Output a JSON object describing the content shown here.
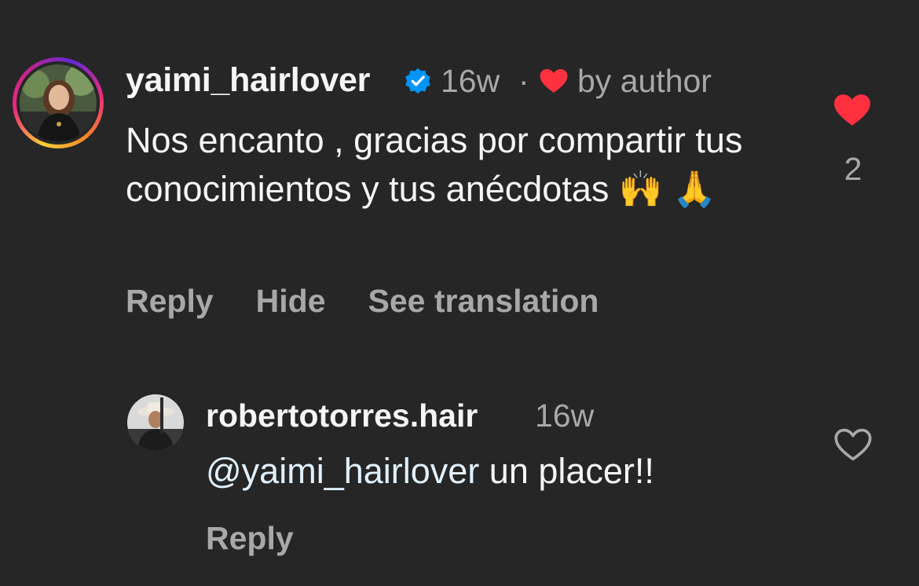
{
  "comment": {
    "username": "yaimi_hairlover",
    "time": "16w",
    "separator": "·",
    "liked_by_author_label": "by author",
    "text": "Nos encanto , gracias por compartir tus conocimientos y tus anécdotas 🙌 🙏",
    "like_count": "2",
    "actions": {
      "reply": "Reply",
      "hide": "Hide",
      "see_translation": "See translation"
    },
    "icons": {
      "avatar": "profile-photo",
      "verified": "verified-badge-icon",
      "author_heart": "heart-filled-icon",
      "like": "heart-filled-icon"
    }
  },
  "reply": {
    "username": "robertotorres.hair",
    "time": "16w",
    "mention": "@yaimi_hairlover",
    "text": " un placer!!",
    "action_reply": "Reply",
    "icons": {
      "avatar": "profile-photo",
      "like": "heart-outline-icon"
    }
  },
  "colors": {
    "background": "#262626",
    "primary_text": "#f5f5f5",
    "secondary_text": "#a8a8a8",
    "heart_red": "#ff3040",
    "verified_blue": "#0095f6",
    "mention": "#e0f1ff"
  }
}
